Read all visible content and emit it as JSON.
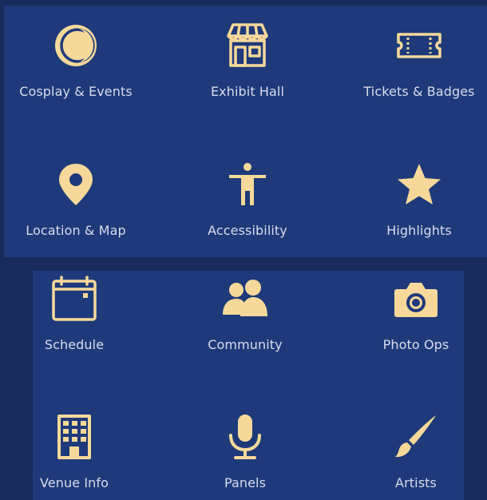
{
  "theme": {
    "background": "#172b5c",
    "panel": "#1e3a7a",
    "icon_color": "#f6d99a",
    "label_color": "#d9dced"
  },
  "menu_top": {
    "items": [
      {
        "label": "Cosplay & Events",
        "icon": "moon-icon"
      },
      {
        "label": "Exhibit Hall",
        "icon": "storefront-icon"
      },
      {
        "label": "Tickets & Badges",
        "icon": "ticket-icon"
      },
      {
        "label": "Location & Map",
        "icon": "map-pin-icon"
      },
      {
        "label": "Accessibility",
        "icon": "accessibility-icon"
      },
      {
        "label": "Highlights",
        "icon": "star-icon"
      }
    ]
  },
  "menu_bottom": {
    "items": [
      {
        "label": "Schedule",
        "icon": "calendar-icon"
      },
      {
        "label": "Community",
        "icon": "users-icon"
      },
      {
        "label": "Photo Ops",
        "icon": "camera-icon"
      },
      {
        "label": "Venue Info",
        "icon": "building-icon"
      },
      {
        "label": "Panels",
        "icon": "microphone-icon"
      },
      {
        "label": "Artists",
        "icon": "paintbrush-icon"
      }
    ]
  }
}
